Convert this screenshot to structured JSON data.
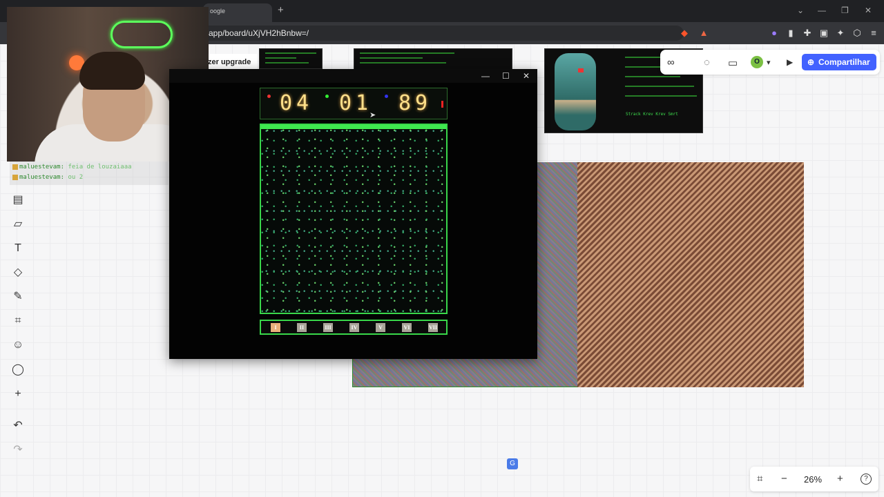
{
  "browser": {
    "tab_title": "oogle",
    "new_tab": "+",
    "url": "app/board/uXjVH2hBnbw=/",
    "win_min": "—",
    "win_max": "❐",
    "win_close": "✕"
  },
  "board": {
    "upgrade_label": "zer upgrade",
    "share_label": "Compartilhar",
    "avatar_initial": "O",
    "zoom": "26%",
    "zoom_out": "−",
    "zoom_in": "+",
    "help": "?"
  },
  "thumbnail": {
    "caption": "Strack Krev Krev Smrt"
  },
  "chat": {
    "messages": [
      {
        "user": "maluestevam:",
        "text": "feia de louzaiaaa"
      },
      {
        "user": "maluestevam:",
        "text": "ou 2"
      }
    ]
  },
  "game": {
    "win_min": "—",
    "win_max": "☐",
    "win_close": "✕",
    "clock": {
      "h": "04",
      "m": "01",
      "s": "89"
    },
    "slots": [
      "I",
      "II",
      "III",
      "IV",
      "V",
      "VI",
      "VII"
    ],
    "active_slot": "I"
  },
  "colors": {
    "accent_share": "#4262ff",
    "game_green": "#39d84a",
    "digit_amber": "#ffe08a"
  }
}
